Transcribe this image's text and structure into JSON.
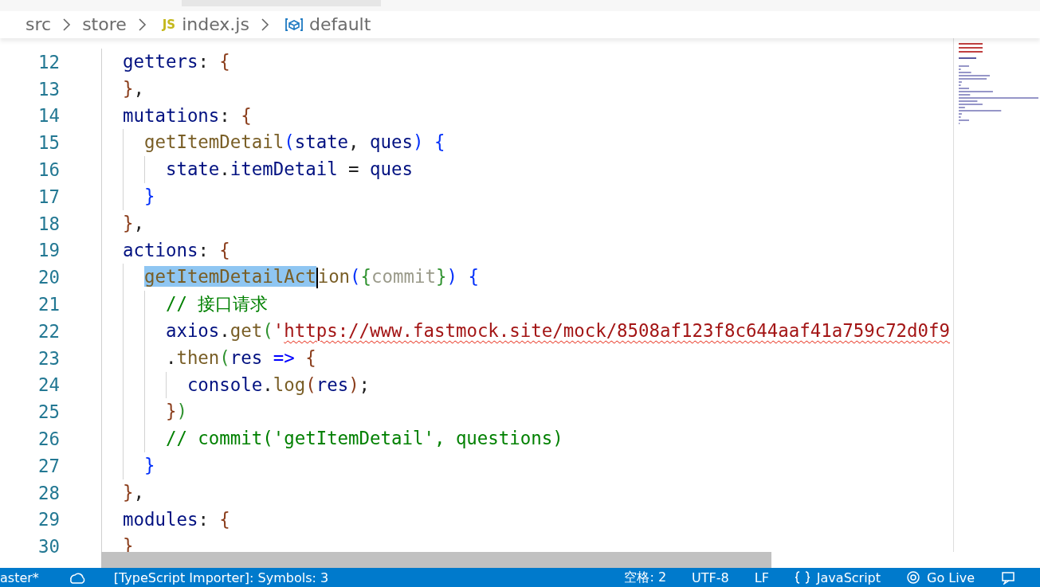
{
  "breadcrumb": [
    {
      "kind": "folder",
      "label": "src"
    },
    {
      "kind": "folder",
      "label": "store"
    },
    {
      "kind": "js-file",
      "icon_text": "JS",
      "label": "index.js"
    },
    {
      "kind": "symbol",
      "label": "default"
    }
  ],
  "editor": {
    "lines": [
      {
        "number": "12",
        "tokens": [
          {
            "kind": "prop",
            "text": "getters"
          },
          {
            "kind": "punc",
            "text": ": "
          },
          {
            "kind": "b1",
            "text": "{"
          }
        ]
      },
      {
        "number": "13",
        "tokens": [
          {
            "kind": "b1",
            "text": "}"
          },
          {
            "kind": "punc",
            "text": ","
          }
        ]
      },
      {
        "number": "14",
        "tokens": [
          {
            "kind": "prop",
            "text": "mutations"
          },
          {
            "kind": "punc",
            "text": ": "
          },
          {
            "kind": "b1",
            "text": "{"
          }
        ]
      },
      {
        "number": "15",
        "tokens": [
          {
            "kind": "fn",
            "text": "  getItemDetail"
          },
          {
            "kind": "b2",
            "text": "("
          },
          {
            "kind": "prop",
            "text": "state"
          },
          {
            "kind": "punc",
            "text": ", "
          },
          {
            "kind": "prop",
            "text": "ques"
          },
          {
            "kind": "b2",
            "text": ")"
          },
          {
            "kind": "b2",
            "text": " {"
          }
        ]
      },
      {
        "number": "16",
        "tokens": [
          {
            "kind": "prop",
            "text": "    state"
          },
          {
            "kind": "punc",
            "text": "."
          },
          {
            "kind": "prop",
            "text": "itemDetail"
          },
          {
            "kind": "punc",
            "text": " = "
          },
          {
            "kind": "prop",
            "text": "ques"
          }
        ]
      },
      {
        "number": "17",
        "tokens": [
          {
            "kind": "b2",
            "text": "  }"
          }
        ]
      },
      {
        "number": "18",
        "tokens": [
          {
            "kind": "b1",
            "text": "}"
          },
          {
            "kind": "punc",
            "text": ","
          }
        ]
      },
      {
        "number": "19",
        "tokens": [
          {
            "kind": "prop",
            "text": "actions"
          },
          {
            "kind": "punc",
            "text": ": "
          },
          {
            "kind": "b1",
            "text": "{"
          }
        ]
      },
      {
        "number": "20",
        "tokens": [
          {
            "kind": "fn",
            "text": "  getItemDetailAct",
            "selected": true
          },
          {
            "kind": "fn",
            "text": "ion"
          },
          {
            "kind": "b2",
            "text": "("
          },
          {
            "kind": "b3",
            "text": "{"
          },
          {
            "kind": "unused",
            "text": "commit"
          },
          {
            "kind": "b3",
            "text": "}"
          },
          {
            "kind": "b2",
            "text": ")"
          },
          {
            "kind": "b2",
            "text": " {"
          }
        ]
      },
      {
        "number": "21",
        "tokens": [
          {
            "kind": "comment",
            "text": "    // 接口请求"
          }
        ]
      },
      {
        "number": "22",
        "tokens": [
          {
            "kind": "prop",
            "text": "    axios"
          },
          {
            "kind": "punc",
            "text": "."
          },
          {
            "kind": "fn",
            "text": "get"
          },
          {
            "kind": "b3",
            "text": "("
          },
          {
            "kind": "str",
            "text": "'"
          },
          {
            "kind": "str",
            "text": "https://www.fastmock.site/mock/8508af123f8c644aaf41a759c72d0f9",
            "error": true
          }
        ]
      },
      {
        "number": "23",
        "tokens": [
          {
            "kind": "punc",
            "text": "    ."
          },
          {
            "kind": "fn",
            "text": "then"
          },
          {
            "kind": "b3",
            "text": "("
          },
          {
            "kind": "prop",
            "text": "res"
          },
          {
            "kind": "kw",
            "text": " => "
          },
          {
            "kind": "b1",
            "text": "{"
          }
        ]
      },
      {
        "number": "24",
        "tokens": [
          {
            "kind": "prop",
            "text": "      console"
          },
          {
            "kind": "punc",
            "text": "."
          },
          {
            "kind": "fn",
            "text": "log"
          },
          {
            "kind": "b1",
            "text": "("
          },
          {
            "kind": "prop",
            "text": "res"
          },
          {
            "kind": "b1",
            "text": ")"
          },
          {
            "kind": "punc",
            "text": ";"
          }
        ]
      },
      {
        "number": "25",
        "tokens": [
          {
            "kind": "b1",
            "text": "    }"
          },
          {
            "kind": "b3",
            "text": ")"
          }
        ]
      },
      {
        "number": "26",
        "tokens": [
          {
            "kind": "comment",
            "text": "    // commit('getItemDetail', questions)"
          }
        ]
      },
      {
        "number": "27",
        "tokens": [
          {
            "kind": "b2",
            "text": "  }"
          }
        ]
      },
      {
        "number": "28",
        "tokens": [
          {
            "kind": "b1",
            "text": "}"
          },
          {
            "kind": "punc",
            "text": ","
          }
        ]
      },
      {
        "number": "29",
        "tokens": [
          {
            "kind": "prop",
            "text": "modules"
          },
          {
            "kind": "punc",
            "text": ": "
          },
          {
            "kind": "b1",
            "text": "{"
          }
        ]
      },
      {
        "number": "30",
        "tokens": [
          {
            "kind": "b1",
            "text": "}"
          }
        ]
      }
    ]
  },
  "status_bar": {
    "left": [
      {
        "kind": "branch",
        "label": "aster*"
      },
      {
        "kind": "sync"
      },
      {
        "kind": "text",
        "label": "[TypeScript Importer]: Symbols: 3"
      }
    ],
    "right": [
      {
        "kind": "text",
        "label": "空格: 2"
      },
      {
        "kind": "text",
        "label": "UTF-8"
      },
      {
        "kind": "text",
        "label": "LF"
      },
      {
        "kind": "language",
        "label": "JavaScript"
      },
      {
        "kind": "live",
        "label": "Go Live"
      },
      {
        "kind": "feedback"
      }
    ]
  }
}
